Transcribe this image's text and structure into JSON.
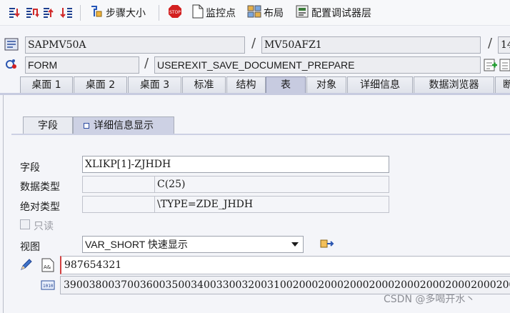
{
  "toolbar": {
    "icons": [
      "step-into-icon",
      "step-over-icon",
      "step-return-icon",
      "run-to-cursor-icon"
    ],
    "step_size_label": "步骤大小",
    "stop_label": "STOP",
    "watchpoint_label": "监控点",
    "layout_label": "布局",
    "config_label": "配置调试器层"
  },
  "program": {
    "main_program": "SAPMV50A",
    "include": "MV50AFZ1",
    "line_partial": "14",
    "event_type": "FORM",
    "event_name": "USEREXIT_SAVE_DOCUMENT_PREPARE"
  },
  "tabs": [
    "桌面 1",
    "桌面 2",
    "桌面 3",
    "标准",
    "结构",
    "表",
    "对象",
    "详细信息",
    "数据浏览器",
    "断"
  ],
  "subtabs": [
    "字段",
    "详细信息显示"
  ],
  "detail": {
    "field_label": "字段",
    "field_value": "XLIKP[1]-ZJHDH",
    "datatype_label": "数据类型",
    "datatype_value": "C(25)",
    "abstype_label": "绝对类型",
    "abstype_value": "\\TYPE=ZDE_JHDH",
    "readonly_label": "只读",
    "view_label": "视图",
    "view_value": "VAR_SHORT 快速显示",
    "content_value": "987654321",
    "hex_value": "390038003700360035003400330032003100200020002000200020002000200020002000"
  },
  "watermark": "CSDN @多喝开水丶",
  "colors": {
    "accent_active_tab": "#c7cbe0",
    "stop_red": "#d32020"
  }
}
